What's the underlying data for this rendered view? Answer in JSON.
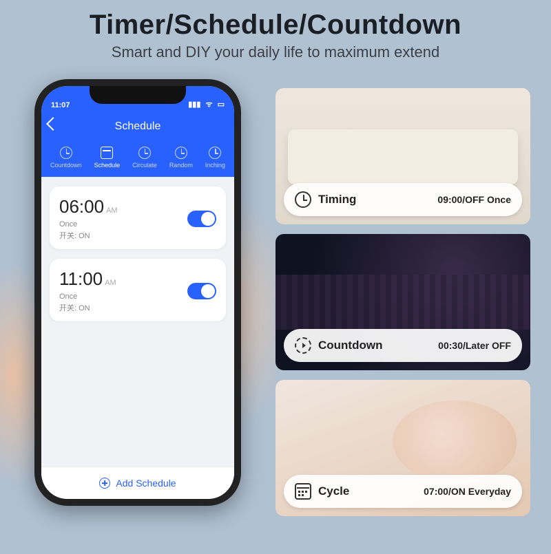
{
  "header": {
    "title": "Timer/Schedule/Countdown",
    "subtitle": "Smart and DIY your daily life to maximum extend"
  },
  "phone": {
    "status_time": "11:07",
    "app_title": "Schedule",
    "tabs": [
      {
        "label": "Countdown"
      },
      {
        "label": "Schedule"
      },
      {
        "label": "Circulate"
      },
      {
        "label": "Random"
      },
      {
        "label": "Inching"
      }
    ],
    "schedules": [
      {
        "time": "06:00",
        "ampm": "AM",
        "repeat": "Once",
        "note": "开关: ON",
        "on": true
      },
      {
        "time": "11:00",
        "ampm": "AM",
        "repeat": "Once",
        "note": "开关: ON",
        "on": true
      }
    ],
    "add_label": "Add Schedule"
  },
  "tiles": [
    {
      "icon": "clock",
      "label": "Timing",
      "value": "09:00/OFF Once"
    },
    {
      "icon": "countdown",
      "label": "Countdown",
      "value": "00:30/Later OFF"
    },
    {
      "icon": "calendar",
      "label": "Cycle",
      "value": "07:00/ON Everyday"
    }
  ]
}
